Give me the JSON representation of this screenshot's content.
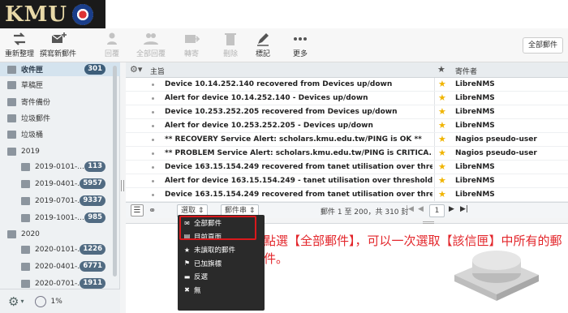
{
  "logo": {
    "text": "KMU"
  },
  "toolbar": {
    "buttons": [
      {
        "label": "重新整理",
        "icon": "refresh-icon",
        "enabled": true
      },
      {
        "label": "撰寫新郵件",
        "icon": "compose-icon",
        "enabled": true
      },
      {
        "label": "回覆",
        "icon": "reply-icon",
        "enabled": false
      },
      {
        "label": "全部回覆",
        "icon": "reply-all-icon",
        "enabled": false
      },
      {
        "label": "轉寄",
        "icon": "forward-icon",
        "enabled": false
      },
      {
        "label": "刪除",
        "icon": "trash-icon",
        "enabled": false
      },
      {
        "label": "標記",
        "icon": "pencil-icon",
        "enabled": true
      },
      {
        "label": "更多",
        "icon": "more-icon",
        "enabled": true
      }
    ],
    "all_mail_label": "全部郵件"
  },
  "sidebar": {
    "folders": [
      {
        "label": "收件匣",
        "badge": "301",
        "selected": true,
        "sub": false
      },
      {
        "label": "草稿匣",
        "badge": "",
        "selected": false,
        "sub": false
      },
      {
        "label": "寄件備份",
        "badge": "",
        "selected": false,
        "sub": false
      },
      {
        "label": "垃圾郵件",
        "badge": "",
        "selected": false,
        "sub": false
      },
      {
        "label": "垃圾桶",
        "badge": "",
        "selected": false,
        "sub": false
      },
      {
        "label": "2019",
        "badge": "",
        "selected": false,
        "sub": false
      },
      {
        "label": "2019-0101-...",
        "badge": "113",
        "selected": false,
        "sub": true
      },
      {
        "label": "2019-0401-...",
        "badge": "5957",
        "selected": false,
        "sub": true
      },
      {
        "label": "2019-0701-...",
        "badge": "9337",
        "selected": false,
        "sub": true
      },
      {
        "label": "2019-1001-...",
        "badge": "985",
        "selected": false,
        "sub": true
      },
      {
        "label": "2020",
        "badge": "",
        "selected": false,
        "sub": false
      },
      {
        "label": "2020-0101-...",
        "badge": "1226",
        "selected": false,
        "sub": true
      },
      {
        "label": "2020-0401-...",
        "badge": "6771",
        "selected": false,
        "sub": true
      },
      {
        "label": "2020-0701-...",
        "badge": "1911",
        "selected": false,
        "sub": true
      }
    ],
    "quota": "1%"
  },
  "list": {
    "col_subject": "主旨",
    "col_from": "寄件者",
    "rows": [
      {
        "subject": "Device 10.14.252.140 recovered from Devices up/down",
        "from": "LibreNMS"
      },
      {
        "subject": "Alert for device 10.14.252.140 - Devices up/down",
        "from": "LibreNMS"
      },
      {
        "subject": "Device 10.253.252.205 recovered from Devices up/down",
        "from": "LibreNMS"
      },
      {
        "subject": "Alert for device 10.253.252.205 - Devices up/down",
        "from": "LibreNMS"
      },
      {
        "subject": "** RECOVERY Service Alert: scholars.kmu.edu.tw/PING is OK **",
        "from": "Nagios pseudo-user"
      },
      {
        "subject": "** PROBLEM Service Alert: scholars.kmu.edu.tw/PING is CRITICA...",
        "from": "Nagios pseudo-user"
      },
      {
        "subject": "Device 163.15.154.249 recovered from tanet utilisation over thre...",
        "from": "LibreNMS"
      },
      {
        "subject": "Alert for device 163.15.154.249 - tanet utilisation over threshold",
        "from": "LibreNMS"
      },
      {
        "subject": "Device 163.15.154.249 recovered from tanet utilisation over thre...",
        "from": "LibreNMS"
      }
    ]
  },
  "footer": {
    "select_label": "選取",
    "threads_label": "郵件串",
    "page_info": "郵件 1 至 200，共 310 封",
    "page_number": "1"
  },
  "dropdown": {
    "items": [
      {
        "label": "全部郵件",
        "icon": "envelope-icon"
      },
      {
        "label": "目前頁面",
        "icon": "page-icon"
      },
      {
        "label": "未讀取的郵件",
        "icon": "star-icon"
      },
      {
        "label": "已加旗標",
        "icon": "flag-icon"
      },
      {
        "label": "反選",
        "icon": "invert-icon"
      },
      {
        "label": "無",
        "icon": "close-icon"
      }
    ]
  },
  "annotation": {
    "text": "點選【全部郵件】，可以一次選取【該信匣】中所有的郵件。"
  },
  "colors": {
    "highlight": "#d9191c",
    "annotation": "#e3262b",
    "badge": "#516b82"
  }
}
